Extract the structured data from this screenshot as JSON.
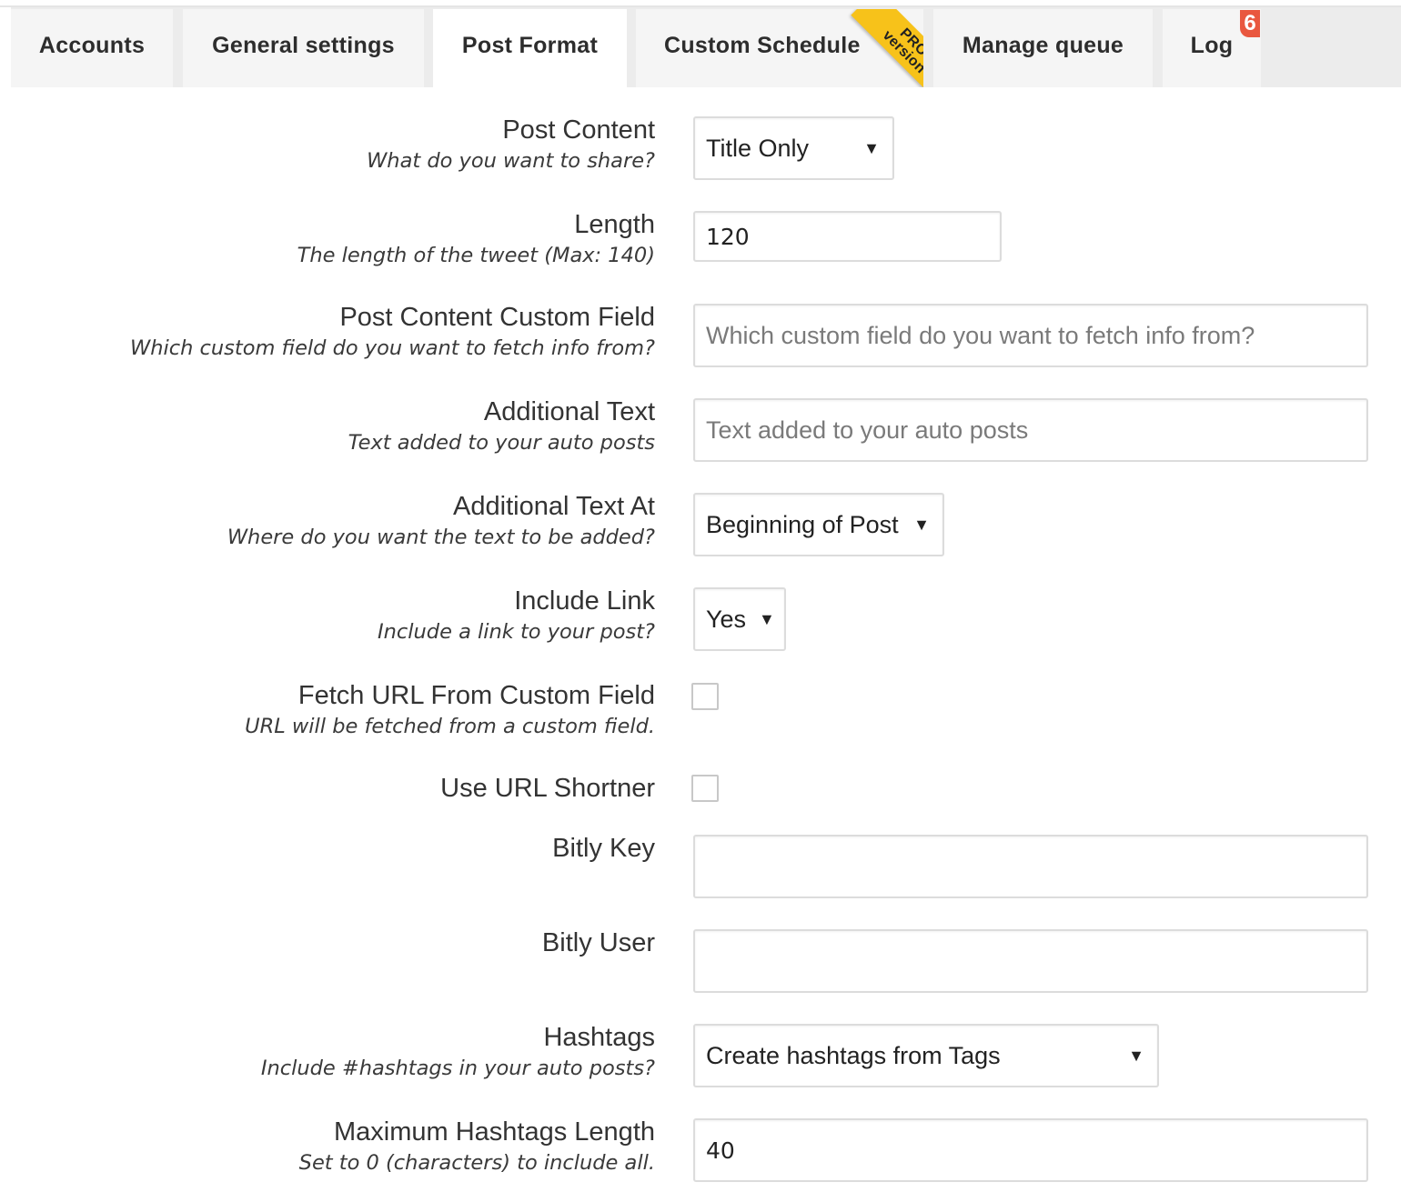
{
  "tabs": [
    {
      "label": "Accounts"
    },
    {
      "label": "General settings"
    },
    {
      "label": "Post Format"
    },
    {
      "label": "Custom Schedule",
      "ribbon_top": "PRO",
      "ribbon_bottom": "version"
    },
    {
      "label": "Manage queue"
    },
    {
      "label": "Log",
      "badge": "6"
    }
  ],
  "active_tab": "Post Format",
  "form": {
    "post_content": {
      "title": "Post Content",
      "desc": "What do you want to share?",
      "value": "Title Only"
    },
    "length": {
      "title": "Length",
      "desc": "The length of the tweet (Max: 140)",
      "value": "120"
    },
    "custom_field": {
      "title": "Post Content Custom Field",
      "desc": "Which custom field do you want to fetch info from?",
      "placeholder": "Which custom field do you want to fetch info from?"
    },
    "additional_text": {
      "title": "Additional Text",
      "desc": "Text added to your auto posts",
      "placeholder": "Text added to your auto posts"
    },
    "additional_text_at": {
      "title": "Additional Text At",
      "desc": "Where do you want the text to be added?",
      "value": "Beginning of Post"
    },
    "include_link": {
      "title": "Include Link",
      "desc": "Include a link to your post?",
      "value": "Yes"
    },
    "fetch_url": {
      "title": "Fetch URL From Custom Field",
      "desc": "URL will be fetched from a custom field.",
      "checked": false
    },
    "url_shortner": {
      "title": "Use URL Shortner",
      "checked": false
    },
    "bitly_key": {
      "title": "Bitly Key",
      "value": ""
    },
    "bitly_user": {
      "title": "Bitly User",
      "value": ""
    },
    "hashtags": {
      "title": "Hashtags",
      "desc": "Include #hashtags in your auto posts?",
      "value": "Create hashtags from Tags"
    },
    "max_hashtags": {
      "title": "Maximum Hashtags Length",
      "desc": "Set to 0 (characters) to include all.",
      "value": "40"
    }
  },
  "icons": {
    "dropdown": "triangle-down"
  },
  "colors": {
    "badge": "#e9573f",
    "ribbon": "#f7c21a",
    "tabbar": "#ececec",
    "tab": "#f5f5f5",
    "active_tab": "#ffffff",
    "border": "#dcdcdc"
  }
}
